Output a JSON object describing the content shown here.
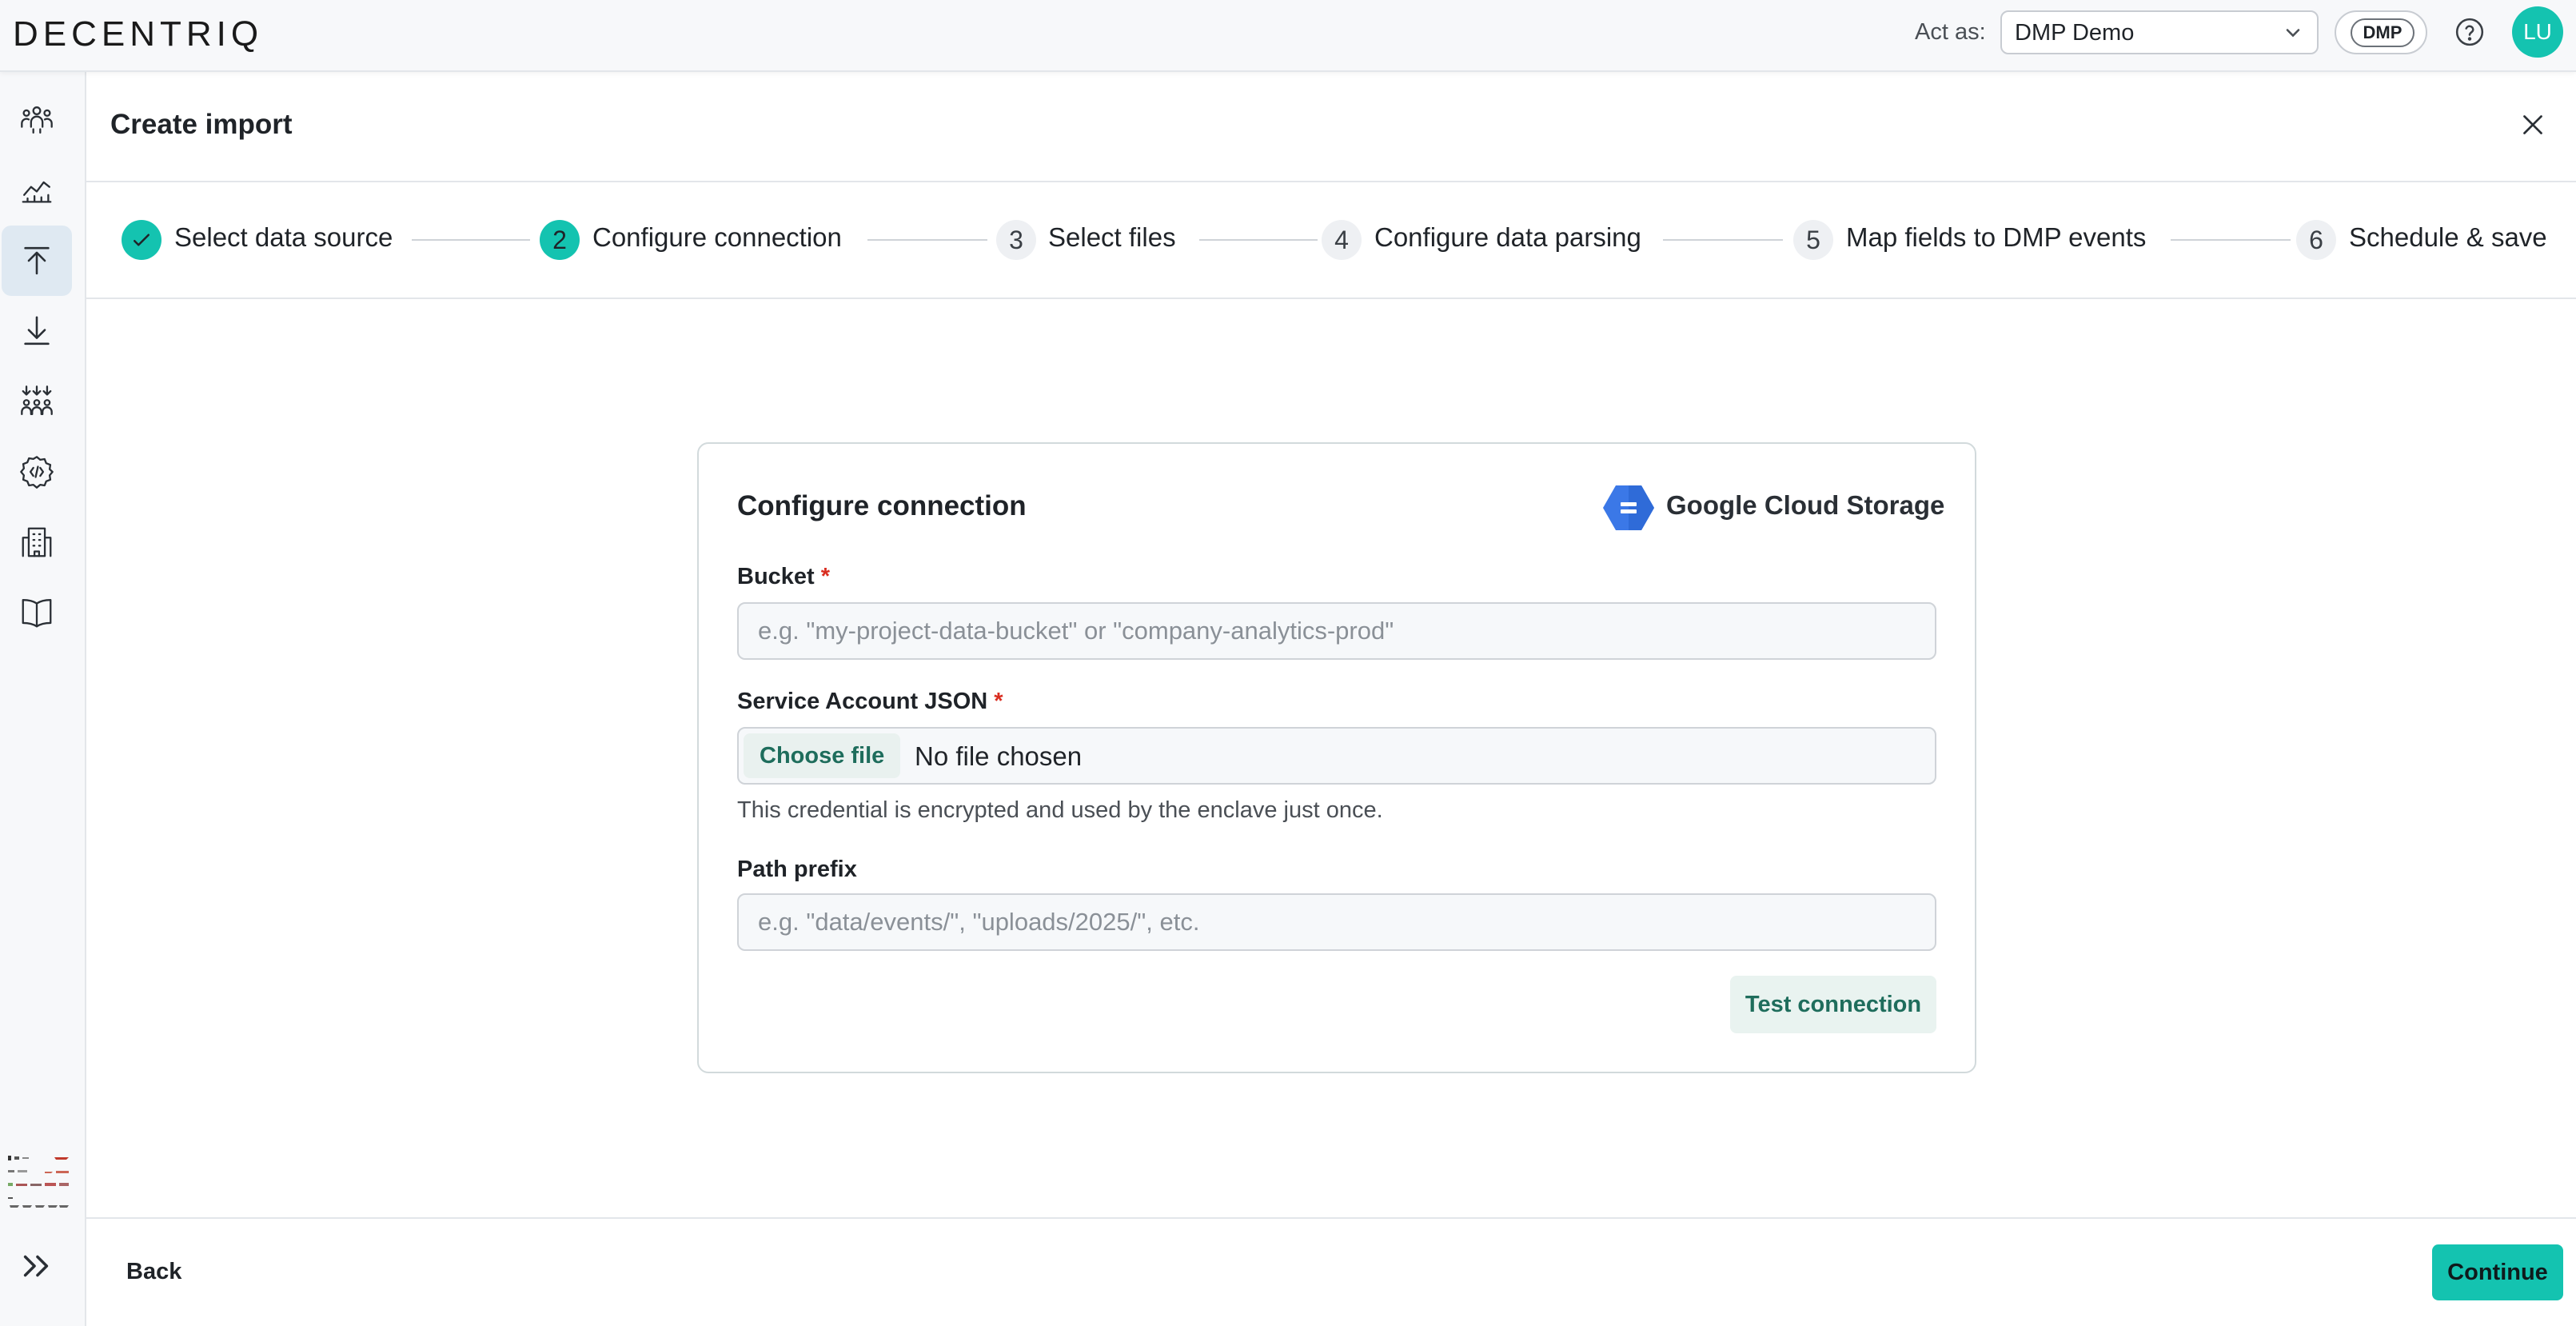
{
  "app": {
    "logo": "DECENTRIQ",
    "act_as_label": "Act as:",
    "act_as_value": "DMP Demo",
    "dmp_badge": "DMP",
    "avatar_initials": "LU",
    "accent_color": "#14c3b0"
  },
  "sidebar": {
    "items": [
      {
        "icon": "audiences-icon",
        "active": false
      },
      {
        "icon": "insights-chart-icon",
        "active": false
      },
      {
        "icon": "import-icon",
        "active": true
      },
      {
        "icon": "export-icon",
        "active": false
      },
      {
        "icon": "audience-merge-icon",
        "active": false
      },
      {
        "icon": "developer-settings-icon",
        "active": false
      },
      {
        "icon": "organization-icon",
        "active": false
      },
      {
        "icon": "documentation-book-icon",
        "active": false
      }
    ]
  },
  "header": {
    "title": "Create import"
  },
  "stepper": {
    "steps": [
      {
        "number": "",
        "label": "Select data source",
        "state": "done"
      },
      {
        "number": "2",
        "label": "Configure connection",
        "state": "current"
      },
      {
        "number": "3",
        "label": "Select files",
        "state": "pending"
      },
      {
        "number": "4",
        "label": "Configure data parsing",
        "state": "pending"
      },
      {
        "number": "5",
        "label": "Map fields to DMP events",
        "state": "pending"
      },
      {
        "number": "6",
        "label": "Schedule & save",
        "state": "pending"
      }
    ]
  },
  "card": {
    "title": "Configure connection",
    "provider": "Google Cloud Storage",
    "bucket": {
      "label": "Bucket",
      "required_mark": "*",
      "value": "",
      "placeholder": "e.g. \"my-project-data-bucket\" or \"company-analytics-prod\""
    },
    "service_account": {
      "label": "Service Account JSON",
      "required_mark": "*",
      "choose_label": "Choose file",
      "file_status": "No file chosen",
      "helper": "This credential is encrypted and used by the enclave just once."
    },
    "path_prefix": {
      "label": "Path prefix",
      "value": "",
      "placeholder": "e.g. \"data/events/\", \"uploads/2025/\", etc."
    },
    "test_button": "Test connection"
  },
  "footer": {
    "back_label": "Back",
    "continue_label": "Continue"
  }
}
